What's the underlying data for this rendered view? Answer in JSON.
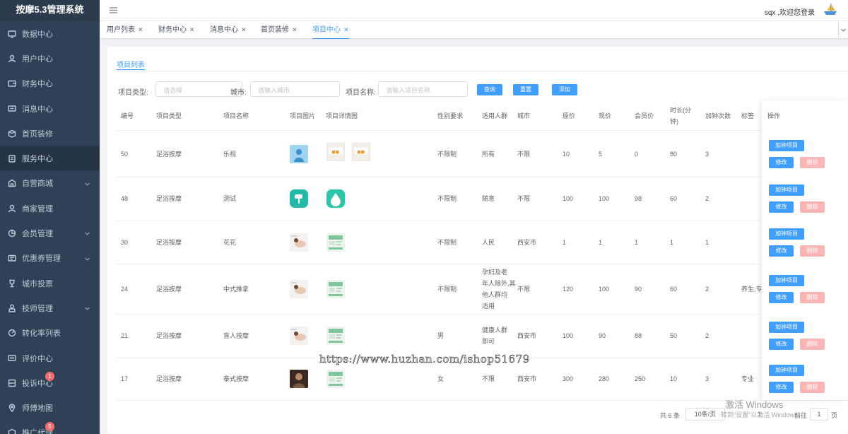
{
  "app": {
    "title": "按摩5.3管理系统"
  },
  "sidebar": {
    "items": [
      {
        "label": "数据中心",
        "icon": "monitor-icon",
        "has_arrow": false,
        "badge": ""
      },
      {
        "label": "用户中心",
        "icon": "user-icon",
        "has_arrow": false,
        "badge": ""
      },
      {
        "label": "财务中心",
        "icon": "wallet-icon",
        "has_arrow": false,
        "badge": ""
      },
      {
        "label": "消息中心",
        "icon": "message-icon",
        "has_arrow": false,
        "badge": ""
      },
      {
        "label": "首页装修",
        "icon": "box-icon",
        "has_arrow": false,
        "badge": ""
      },
      {
        "label": "服务中心",
        "icon": "clipboard-icon",
        "has_arrow": false,
        "badge": "",
        "active": true
      },
      {
        "label": "自营商城",
        "icon": "shop-icon",
        "has_arrow": true,
        "badge": ""
      },
      {
        "label": "商家管理",
        "icon": "merchant-icon",
        "has_arrow": false,
        "badge": ""
      },
      {
        "label": "会员管理",
        "icon": "pie-icon",
        "has_arrow": true,
        "badge": ""
      },
      {
        "label": "优惠券管理",
        "icon": "coupon-icon",
        "has_arrow": true,
        "badge": ""
      },
      {
        "label": "城市投票",
        "icon": "trophy-icon",
        "has_arrow": false,
        "badge": ""
      },
      {
        "label": "技师管理",
        "icon": "staff-icon",
        "has_arrow": true,
        "badge": ""
      },
      {
        "label": "转化率列表",
        "icon": "chart-icon",
        "has_arrow": false,
        "badge": ""
      },
      {
        "label": "评价中心",
        "icon": "comment-icon",
        "has_arrow": false,
        "badge": ""
      },
      {
        "label": "投诉中心",
        "icon": "complaint-icon",
        "has_arrow": false,
        "badge": "1"
      },
      {
        "label": "师傅地图",
        "icon": "location-icon",
        "has_arrow": false,
        "badge": ""
      },
      {
        "label": "推广代理",
        "icon": "promote-icon",
        "has_arrow": false,
        "badge": "5"
      }
    ]
  },
  "header": {
    "user_text": "sqx ,欢迎您登录"
  },
  "tabs": [
    {
      "label": "用户列表",
      "close": "✕"
    },
    {
      "label": "财务中心",
      "close": "✕"
    },
    {
      "label": "消息中心",
      "close": "✕"
    },
    {
      "label": "首页装修",
      "close": "✕"
    },
    {
      "label": "项目中心",
      "close": "✕",
      "active": true
    }
  ],
  "card": {
    "tab_label": "项目列表"
  },
  "filters": {
    "type_label": "项目类型:",
    "type_placeholder": "请选择",
    "city_label": "城市:",
    "city_placeholder": "请输入城市",
    "name_label": "项目名称:",
    "name_placeholder": "请输入项目名称",
    "search_btn": "查询",
    "reset_btn": "重置",
    "add_btn": "添加"
  },
  "table": {
    "headers": {
      "id": "编号",
      "type": "项目类型",
      "name": "项目名称",
      "img": "项目图片",
      "detail": "项目详情图",
      "gender": "性别要求",
      "crowd": "适用人群",
      "city": "城市",
      "price": "原价",
      "now": "现价",
      "vip": "会员价",
      "dur1": "时长(分",
      "dur2": "钟)",
      "extra": "加钟次数",
      "tag": "标签",
      "ops": "操作"
    },
    "rows": [
      {
        "id": "50",
        "type": "足浴按摩",
        "name": "乐视",
        "gender": "不限制",
        "crowd": [
          "所有"
        ],
        "city": "不限",
        "price": "10",
        "now": "5",
        "vip": "0",
        "dur": "80",
        "extra": "3",
        "tag": ""
      },
      {
        "id": "48",
        "type": "足浴按摩",
        "name": "测试",
        "gender": "不限制",
        "crowd": [
          "随意"
        ],
        "city": "不限",
        "price": "100",
        "now": "100",
        "vip": "98",
        "dur": "60",
        "extra": "2",
        "tag": ""
      },
      {
        "id": "30",
        "type": "足浴按摩",
        "name": "花花",
        "gender": "不限制",
        "crowd": [
          "人民"
        ],
        "city": "西安市",
        "price": "1",
        "now": "1",
        "vip": "1",
        "dur": "1",
        "extra": "1",
        "tag": ""
      },
      {
        "id": "24",
        "type": "足浴按摩",
        "name": "中式推拿",
        "gender": "不限制",
        "crowd": [
          "孕妇及老",
          "年人除外,其",
          "他人群均",
          "适用"
        ],
        "city": "不限",
        "price": "120",
        "now": "100",
        "vip": "90",
        "dur": "60",
        "extra": "2",
        "tag": "养生,专"
      },
      {
        "id": "21",
        "type": "足浴按摩",
        "name": "盲人按摩",
        "gender": "男",
        "crowd": [
          "健康人群",
          "即可"
        ],
        "city": "西安市",
        "price": "100",
        "now": "90",
        "vip": "88",
        "dur": "50",
        "extra": "2",
        "tag": ""
      },
      {
        "id": "17",
        "type": "足浴按摩",
        "name": "泰式按摩",
        "gender": "女",
        "crowd": [
          "不限"
        ],
        "city": "西安市",
        "price": "300",
        "now": "280",
        "vip": "250",
        "dur": "10",
        "extra": "3",
        "tag": "专业"
      }
    ],
    "op_add": "加钟项目",
    "op_edit": "修改",
    "op_del": "删除"
  },
  "pagination": {
    "total": "共 6 条",
    "page_size": "10条/页",
    "current": "1",
    "goto_label": "前往",
    "goto_value": "1",
    "page_unit": "页"
  },
  "overlay": {
    "watermark": "https://www.huzhan.com/ishop51679",
    "activate_title": "激活 Windows",
    "activate_sub": "转到\"设置\"以激活 Windows。"
  }
}
